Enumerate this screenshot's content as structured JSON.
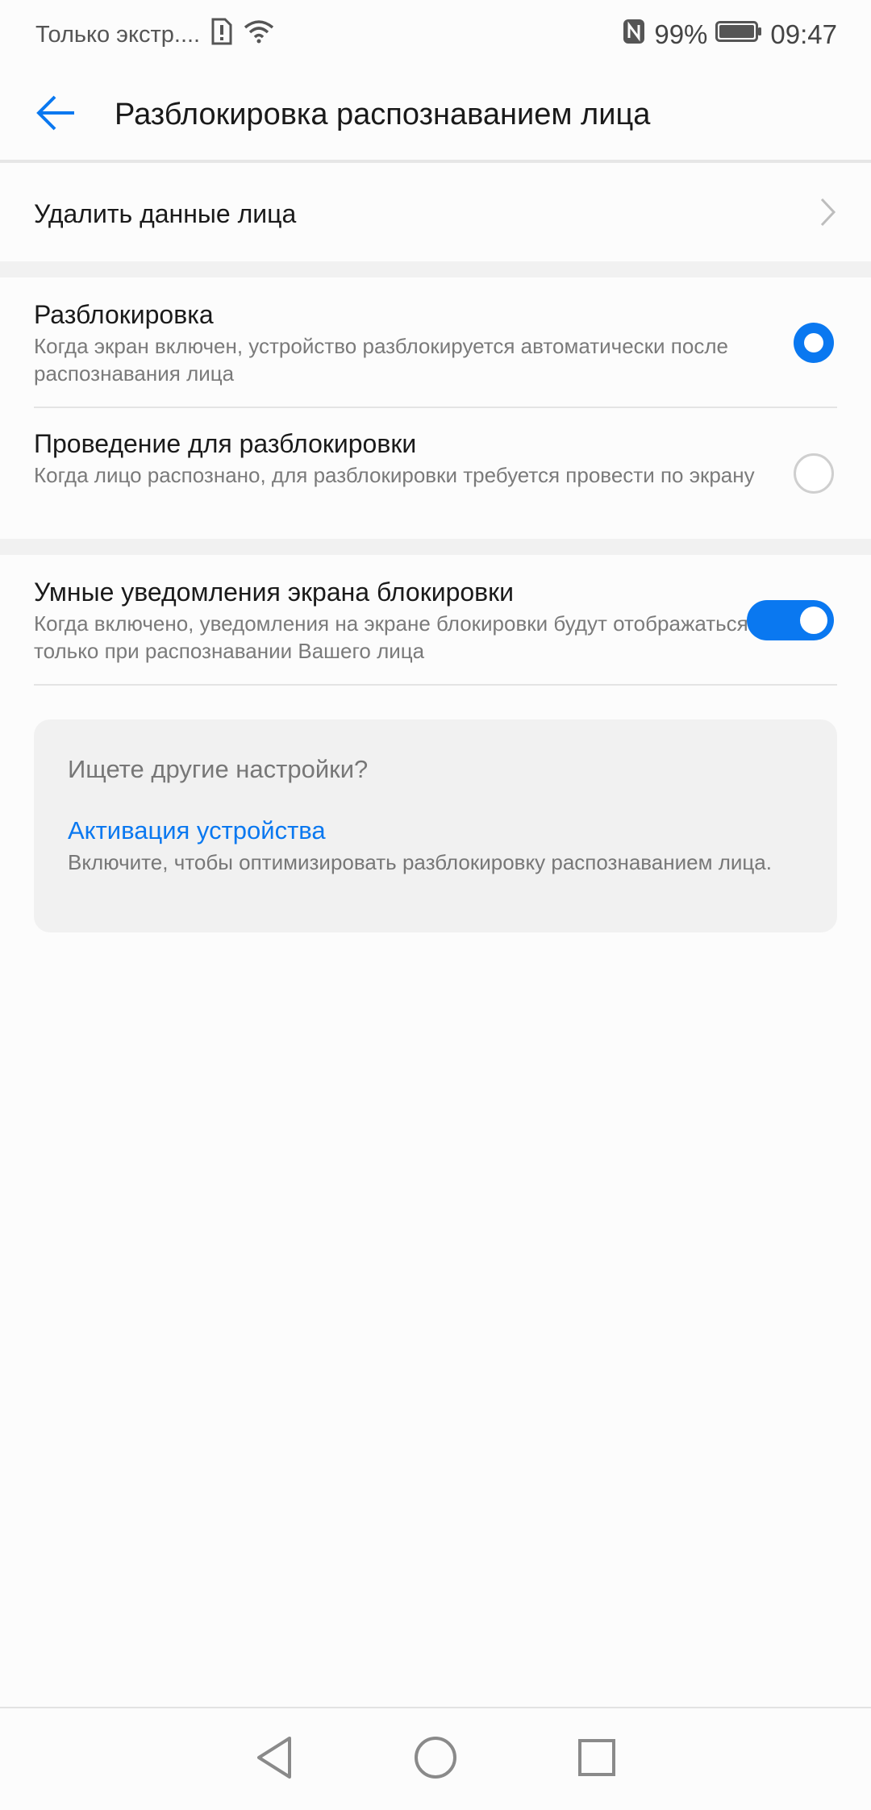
{
  "status_bar": {
    "carrier": "Только экстр....",
    "battery_percent": "99%",
    "time": "09:47",
    "icons": [
      "sim-alert-icon",
      "wifi-icon",
      "nfc-icon",
      "battery-icon"
    ]
  },
  "header": {
    "title": "Разблокировка распознаванием лица",
    "back_icon": "arrow-left-icon"
  },
  "delete_row": {
    "label": "Удалить данные лица",
    "icon": "chevron-right-icon"
  },
  "unlock_options": [
    {
      "title": "Разблокировка",
      "description": "Когда экран включен, устройство разблокируется автоматически после распознавания лица",
      "selected": true
    },
    {
      "title": "Проведение для разблокировки",
      "description": "Когда лицо распознано, для разблокировки требуется провести по экрану",
      "selected": false
    }
  ],
  "smart_notifications": {
    "title": "Умные уведомления экрана блокировки",
    "description": "Когда включено, уведомления на экране блокировки будут отображаться только при распознавании Вашего лица",
    "enabled": true
  },
  "suggestion_card": {
    "question": "Ищете другие настройки?",
    "link": "Активация устройства",
    "description": "Включите, чтобы оптимизировать разблокировку распознаванием лица."
  },
  "nav_bar": {
    "icons": [
      "back-triangle-icon",
      "home-circle-icon",
      "recents-square-icon"
    ]
  },
  "colors": {
    "accent": "#0a78f0",
    "background": "#fcfcfc",
    "card": "#f1f1f1"
  }
}
